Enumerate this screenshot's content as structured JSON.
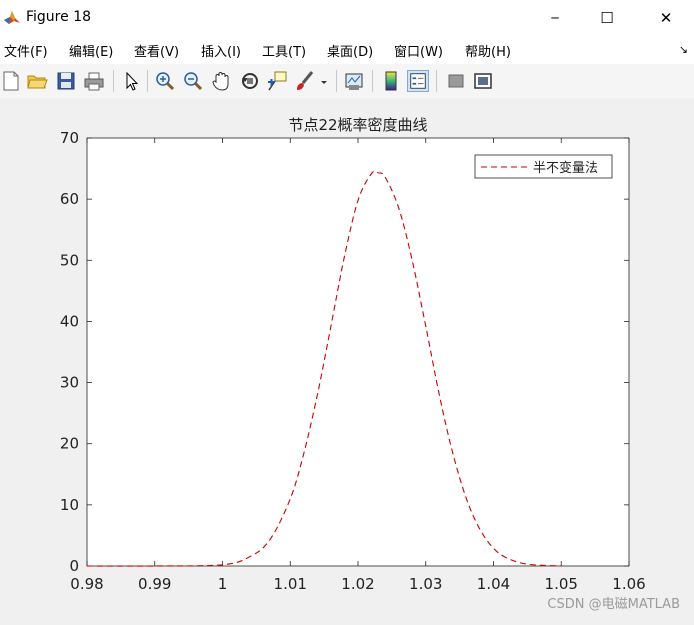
{
  "window": {
    "title": "Figure 18"
  },
  "window_buttons": {
    "minimize": "─",
    "maximize": "☐",
    "close": "✕"
  },
  "menu": {
    "items": [
      "文件(F)",
      "编辑(E)",
      "查看(V)",
      "插入(I)",
      "工具(T)",
      "桌面(D)",
      "窗口(W)",
      "帮助(H)"
    ],
    "dock_glyph": "↘"
  },
  "toolbar": {
    "buttons": [
      {
        "icon": "new-figure-icon"
      },
      {
        "icon": "open-file-icon"
      },
      {
        "icon": "save-icon"
      },
      {
        "icon": "print-icon"
      },
      {
        "icon": "edit-pointer-icon"
      },
      {
        "icon": "zoom-in-icon"
      },
      {
        "icon": "zoom-out-icon"
      },
      {
        "icon": "pan-hand-icon"
      },
      {
        "icon": "rotate-3d-icon"
      },
      {
        "icon": "data-cursor-icon"
      },
      {
        "icon": "brush-icon"
      },
      {
        "icon": "link-plot-icon"
      },
      {
        "icon": "colorbar-icon"
      },
      {
        "icon": "legend-icon"
      },
      {
        "icon": "hide-plot-tools-icon"
      },
      {
        "icon": "show-plot-tools-icon"
      }
    ],
    "active": "legend-icon"
  },
  "chart_data": {
    "type": "line",
    "title": "节点22概率密度曲线",
    "xlabel": "",
    "ylabel": "",
    "xlim": [
      0.98,
      1.06
    ],
    "ylim": [
      0,
      70
    ],
    "xticks": [
      "0.98",
      "0.99",
      "1",
      "1.01",
      "1.02",
      "1.03",
      "1.04",
      "1.05",
      "1.06"
    ],
    "yticks": [
      "0",
      "10",
      "20",
      "30",
      "40",
      "50",
      "60",
      "70"
    ],
    "grid": false,
    "legend": "top-right",
    "series": [
      {
        "name": "半不变量法",
        "color": "#cc0000",
        "style": "dashed",
        "x": [
          0.98,
          0.99,
          1.0,
          1.004,
          1.007,
          1.01,
          1.012,
          1.014,
          1.016,
          1.018,
          1.02,
          1.022,
          1.023,
          1.024,
          1.026,
          1.028,
          1.03,
          1.032,
          1.034,
          1.036,
          1.038,
          1.04,
          1.042,
          1.045,
          1.05
        ],
        "y": [
          0,
          0,
          0.2,
          1.5,
          4.3,
          11.0,
          18.4,
          28.0,
          39.2,
          50.6,
          59.8,
          64.2,
          64.3,
          63.6,
          58.6,
          50.0,
          39.2,
          28.0,
          18.4,
          11.0,
          6.0,
          2.9,
          1.3,
          0.3,
          0
        ]
      }
    ]
  },
  "watermark": "CSDN @电磁MATLAB"
}
